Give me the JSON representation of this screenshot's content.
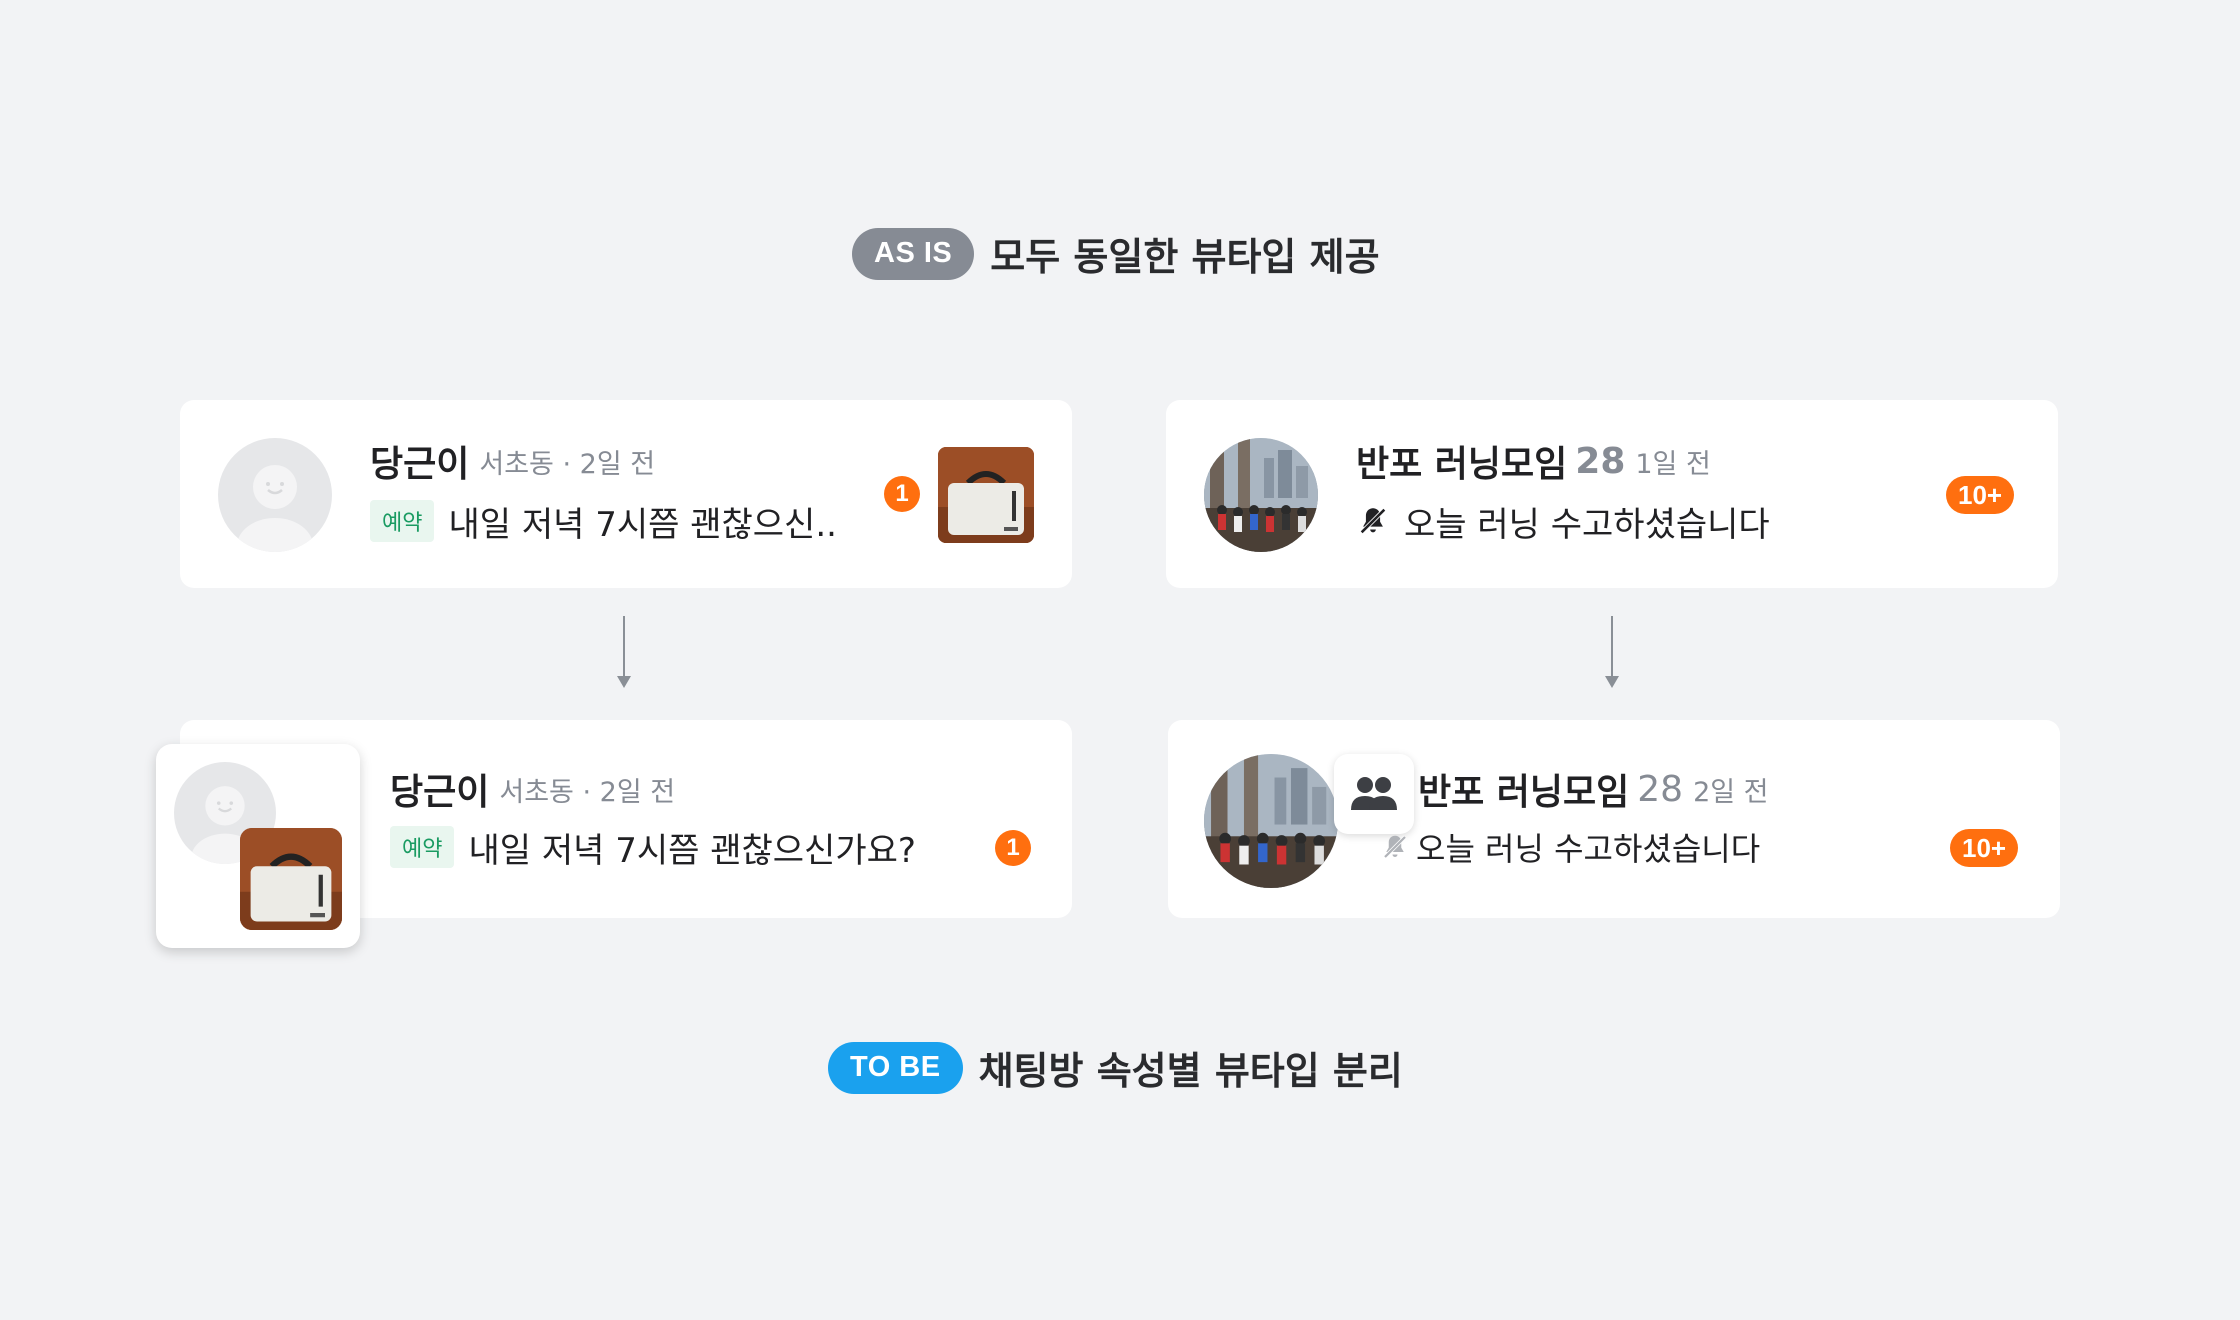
{
  "as_is": {
    "badge": "AS IS",
    "title": "모두 동일한 뷰타입 제공"
  },
  "to_be": {
    "badge": "TO BE",
    "title": "채팅방 속성별 뷰타입 분리"
  },
  "before_dm": {
    "name": "당근이",
    "meta": "서초동 · 2일 전",
    "tag": "예약",
    "message": "내일 저녁 7시쯤 괜찮으신..",
    "unread": "1"
  },
  "before_group": {
    "name": "반포 러닝모임",
    "member_count": "28",
    "meta": "1일 전",
    "message": "오늘 러닝 수고하셨습니다",
    "unread": "10+"
  },
  "after_dm": {
    "name": "당근이",
    "meta": "서초동 · 2일 전",
    "tag": "예약",
    "message": "내일 저녁 7시쯤 괜찮으신가요?",
    "unread": "1"
  },
  "after_group": {
    "name": "반포 러닝모임",
    "member_count": "28",
    "meta": "2일 전",
    "message": "오늘 러닝 수고하셨습니다",
    "unread": "10+"
  },
  "colors": {
    "accent": "#ff6f0f",
    "as_is_pill": "#868b94",
    "to_be_pill": "#1aa1ee",
    "tag_green": "#1a9b62"
  },
  "icons": [
    "person-placeholder-icon",
    "bag-thumbnail",
    "muted-bell-icon",
    "group-people-icon",
    "down-arrow-icon"
  ]
}
